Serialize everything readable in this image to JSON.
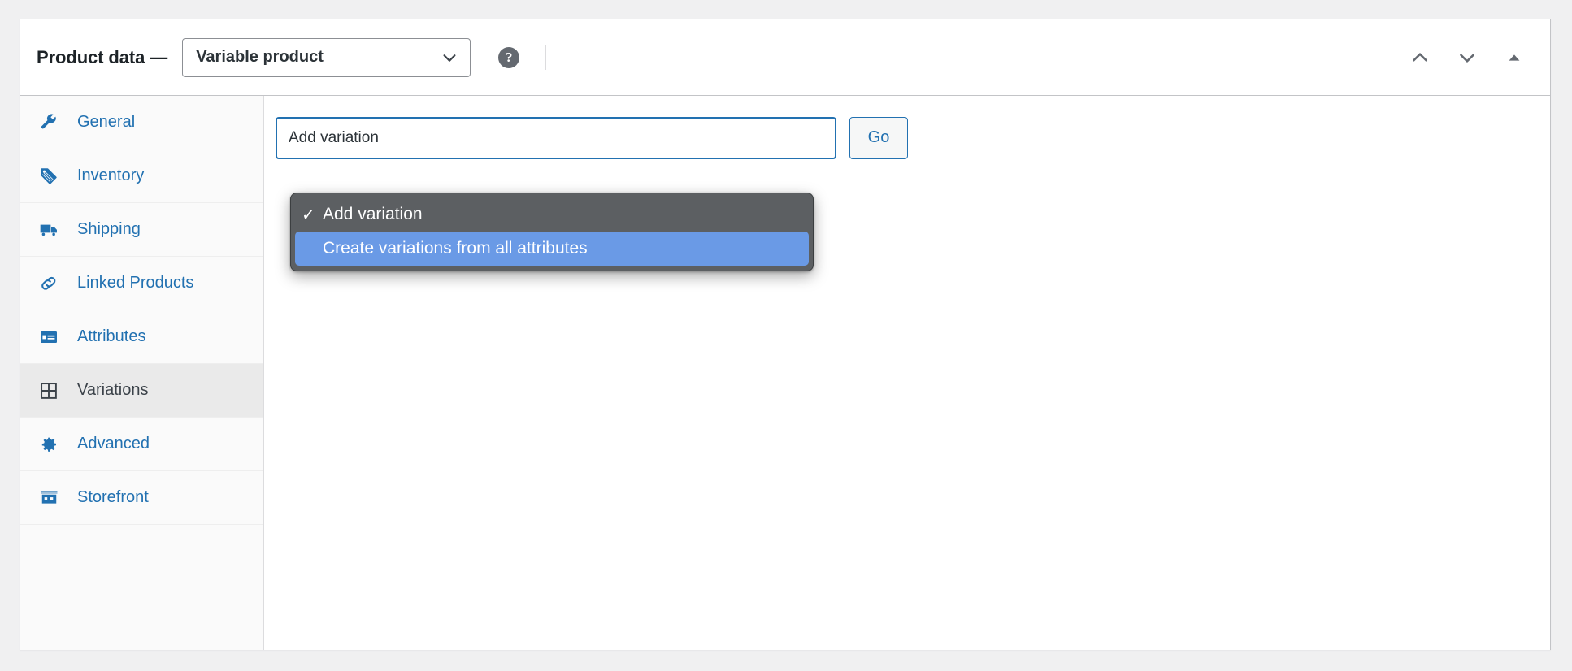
{
  "header": {
    "title": "Product data —",
    "product_type": {
      "selected": "Variable product",
      "icon": "chevron-down-icon"
    },
    "help_icon": "help-circle-icon",
    "actions": [
      {
        "name": "move-up",
        "icon": "chevron-up-icon"
      },
      {
        "name": "move-down",
        "icon": "chevron-down-icon"
      },
      {
        "name": "toggle-panel",
        "icon": "triangle-up-icon"
      }
    ]
  },
  "tabs": [
    {
      "label": "General",
      "icon": "wrench-icon",
      "active": false
    },
    {
      "label": "Inventory",
      "icon": "tag-icon",
      "active": false
    },
    {
      "label": "Shipping",
      "icon": "truck-icon",
      "active": false
    },
    {
      "label": "Linked Products",
      "icon": "link-icon",
      "active": false
    },
    {
      "label": "Attributes",
      "icon": "list-box-icon",
      "active": false
    },
    {
      "label": "Variations",
      "icon": "grid-icon",
      "active": true
    },
    {
      "label": "Advanced",
      "icon": "gear-icon",
      "active": false
    },
    {
      "label": "Storefront",
      "icon": "store-icon",
      "active": false
    }
  ],
  "variations_toolbar": {
    "bulk_action_value": "Add variation",
    "go_label": "Go"
  },
  "dropdown_menu": {
    "open": true,
    "items": [
      {
        "label": "Add variation",
        "checked": true,
        "highlighted": false
      },
      {
        "label": "Create variations from all attributes",
        "checked": false,
        "highlighted": true
      }
    ],
    "checkmark": "✓"
  },
  "colors": {
    "link_blue": "#2271b1",
    "menu_bg": "#5c5f62",
    "menu_highlight": "#6a9ae6",
    "active_tab_bg": "#eaeaea",
    "page_bg": "#f0f0f1"
  }
}
